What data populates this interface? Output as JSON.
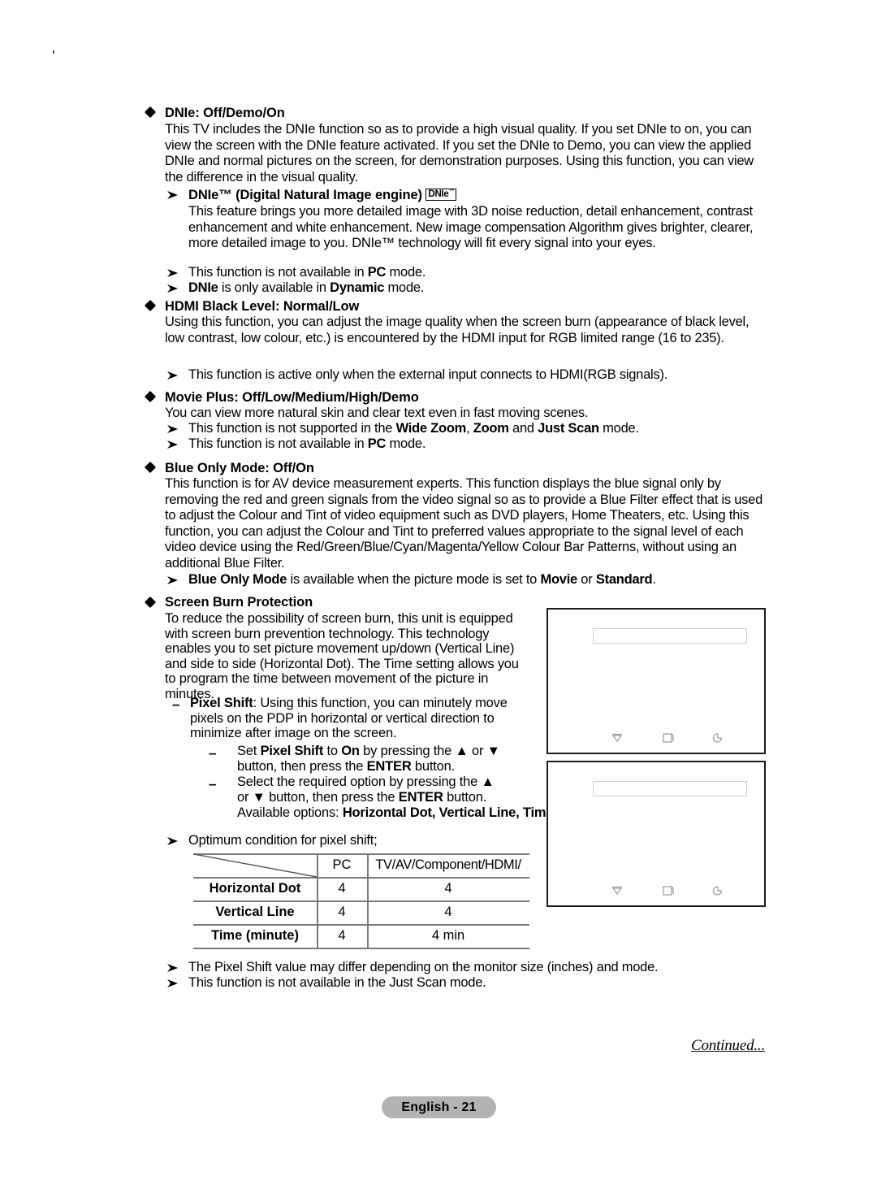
{
  "page": {
    "footer_badge": "English - 21",
    "continued": "Continued..."
  },
  "sections": [
    {
      "id": "dnie",
      "bullet": "diamond",
      "heading": "DNIe: Off/Demo/On",
      "body": "This TV includes the DNIe function so as to provide a high visual quality. If you set DNIe to on, you can view the screen with the DNIe feature activated. If you set the DNIe to Demo, you can view the applied DNIe and normal pictures on the screen, for demonstration purposes. Using this function, you can view the difference in the visual quality.",
      "notes": [
        {
          "bullet": "arrow",
          "heading": "DNIe™ (Digital Natural Image engine)",
          "badge": "DNIe",
          "body": "This feature brings you more detailed image with 3D noise reduction, detail enhancement, contrast enhancement and white enhancement. New image compensation Algorithm gives brighter, clearer, more detailed image to you. DNIe™ technology will fit every signal into your eyes."
        },
        {
          "bullet": "arrow",
          "text": "This function is not available in PC mode."
        },
        {
          "bullet": "arrow",
          "text": "DNIe is only available in Dynamic mode."
        }
      ]
    },
    {
      "id": "hdmi-black-level",
      "bullet": "diamond",
      "heading": "HDMI Black Level: Normal/Low",
      "body": "Using this function, you can adjust the image quality when the screen burn (appearance of black level, low contrast, low colour, etc.) is encountered by the HDMI input for RGB limited range (16 to 235).",
      "notes": [
        {
          "bullet": "arrow",
          "text": "This function is active only when the external input connects to HDMI(RGB signals)."
        }
      ]
    },
    {
      "id": "movie-plus",
      "bullet": "diamond",
      "heading": "Movie Plus: Off/Low/Medium/High/Demo",
      "body": "You can view more natural skin and clear text even in fast moving scenes.",
      "notes": [
        {
          "bullet": "arrow",
          "text": "This function is not supported in the Wide Zoom, Zoom and Just Scan mode."
        },
        {
          "bullet": "arrow",
          "text": "This function is not available in PC mode."
        }
      ]
    },
    {
      "id": "blue-only-mode",
      "bullet": "diamond",
      "heading": "Blue Only Mode: Off/On",
      "body": "This function is for AV device measurement experts. This function displays the blue signal only by removing the red and green signals from the video signal so as to provide a Blue Filter effect that is used to adjust the Colour and Tint of video equipment such as DVD players, Home Theaters, etc. Using this function, you can adjust the Colour and Tint to preferred values appropriate to the signal level of each video device using the Red/Green/Blue/Cyan/Magenta/Yellow Colour Bar Patterns, without using an additional Blue Filter.",
      "notes": [
        {
          "bullet": "arrow",
          "text": "Blue Only Mode is available when the picture mode is set to Movie or Standard."
        }
      ]
    },
    {
      "id": "screen-burn-protection",
      "bullet": "diamond",
      "heading": "Screen Burn Protection",
      "body": "To reduce the possibility of screen burn, this unit is equipped with screen burn prevention technology. This technology enables you to set picture movement up/down (Vertical Line) and side to side (Horizontal Dot). The Time setting allows you to program the time between movement of the picture in minutes.",
      "pixel_shift": {
        "bullet": "dash",
        "label": "Pixel Shift",
        "text": ": Using this function, you can minutely move pixels on the PDP in horizontal or vertical direction to minimize after image on the screen.",
        "steps": [
          "Set Pixel Shift to On by pressing the ▲ or ▼ button, then press the ENTER button.",
          "Select the required option by pressing the ▲ or ▼ button, then press the ENTER button."
        ],
        "available_options_label": "Available options:",
        "available_options": "Horizontal Dot, Vertical Line, Time"
      },
      "optimum_note": "Optimum condition for pixel shift;",
      "closing_notes": [
        {
          "bullet": "arrow",
          "text": "The Pixel Shift value may differ depending on the monitor size (inches) and mode."
        },
        {
          "bullet": "arrow",
          "text": "This function is not available in the Just Scan mode."
        }
      ]
    }
  ],
  "pixel_shift_table": {
    "columns": [
      "",
      "PC",
      "TV/AV/Component/HDMI/"
    ],
    "rows": [
      {
        "label": "Horizontal Dot",
        "pc": "4",
        "av": "4"
      },
      {
        "label": "Vertical Line",
        "pc": "4",
        "av": "4"
      },
      {
        "label": "Time (minute)",
        "pc": "4",
        "av": "4 min"
      }
    ]
  },
  "osd_panels": [
    {
      "id": "osd-panel-1",
      "icons": [
        "move-icon",
        "enter-icon",
        "return-icon"
      ]
    },
    {
      "id": "osd-panel-2",
      "icons": [
        "move-icon",
        "enter-icon",
        "return-icon"
      ]
    }
  ]
}
